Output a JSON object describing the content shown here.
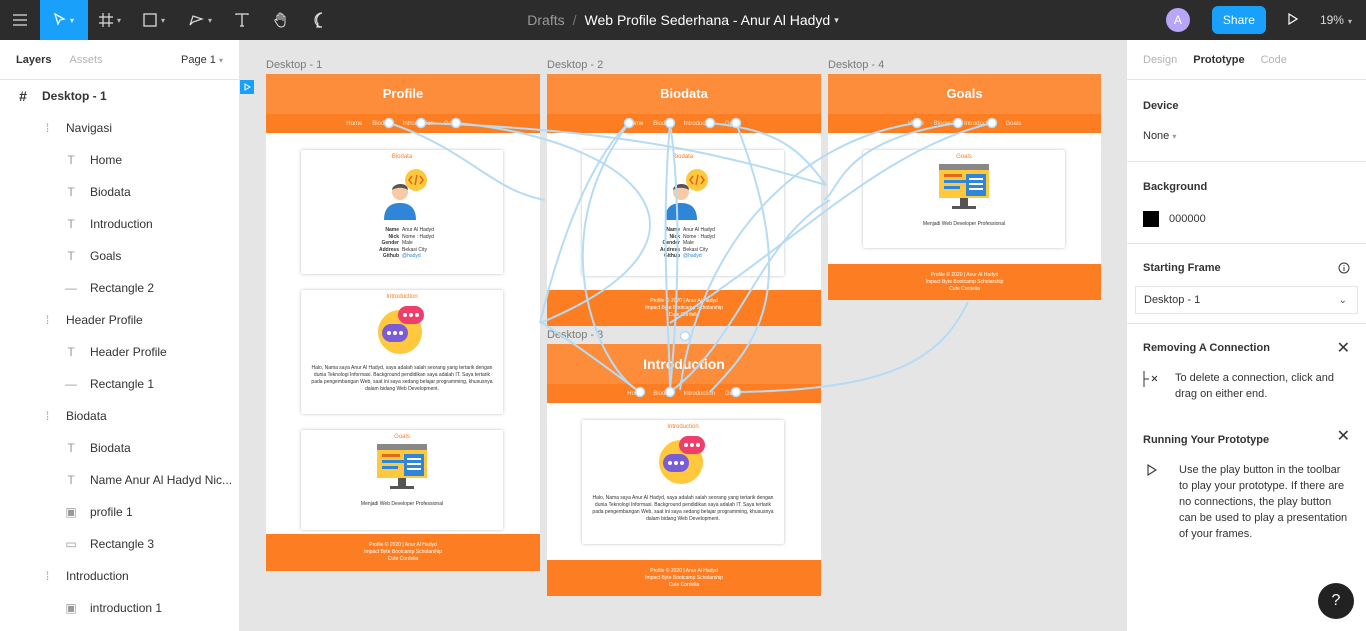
{
  "toolbar": {
    "breadcrumb": "Drafts",
    "separator": "/",
    "document_title": "Web Profile Sederhana - Anur Al Hadyd",
    "avatar_initial": "A",
    "share_label": "Share",
    "zoom": "19%"
  },
  "left_panel": {
    "tab_layers": "Layers",
    "tab_assets": "Assets",
    "page": "Page 1",
    "layers": [
      {
        "label": "Desktop - 1",
        "indent": 0,
        "icon": "frame-icon"
      },
      {
        "label": "Navigasi",
        "indent": 1,
        "icon": "group-icon"
      },
      {
        "label": "Home",
        "indent": 2,
        "icon": "text-icon"
      },
      {
        "label": "Biodata",
        "indent": 2,
        "icon": "text-icon"
      },
      {
        "label": "Introduction",
        "indent": 2,
        "icon": "text-icon"
      },
      {
        "label": "Goals",
        "indent": 2,
        "icon": "text-icon"
      },
      {
        "label": "Rectangle 2",
        "indent": 2,
        "icon": "line-icon"
      },
      {
        "label": "Header Profile",
        "indent": 1,
        "icon": "group-icon"
      },
      {
        "label": "Header Profile",
        "indent": 2,
        "icon": "text-icon"
      },
      {
        "label": "Rectangle 1",
        "indent": 2,
        "icon": "line-icon"
      },
      {
        "label": "Biodata",
        "indent": 1,
        "icon": "group-icon"
      },
      {
        "label": "Biodata",
        "indent": 2,
        "icon": "text-icon"
      },
      {
        "label": "Name Anur Al Hadyd Nic...",
        "indent": 2,
        "icon": "text-icon"
      },
      {
        "label": "profile 1",
        "indent": 2,
        "icon": "image-icon"
      },
      {
        "label": "Rectangle 3",
        "indent": 2,
        "icon": "rectangle-icon"
      },
      {
        "label": "Introduction",
        "indent": 1,
        "icon": "group-icon"
      },
      {
        "label": "introduction 1",
        "indent": 2,
        "icon": "image-icon"
      }
    ]
  },
  "right_panel": {
    "tab_design": "Design",
    "tab_prototype": "Prototype",
    "tab_code": "Code",
    "device_heading": "Device",
    "device_value": "None",
    "background_heading": "Background",
    "background_value": "000000",
    "starting_frame_heading": "Starting Frame",
    "starting_frame_value": "Desktop - 1",
    "removing_heading": "Removing A Connection",
    "removing_text": "To delete a connection, click and drag on either end.",
    "running_heading": "Running Your Prototype",
    "running_text": "Use the play button in the toolbar to play your prototype. If there are no connections, the play button can be used to play a presentation of your frames."
  },
  "canvas": {
    "frames": [
      {
        "label": "Desktop - 1",
        "header": "Profile"
      },
      {
        "label": "Desktop - 2",
        "header": "Biodata"
      },
      {
        "label": "Desktop - 4",
        "header": "Goals"
      },
      {
        "label": "Desktop - 3",
        "header": "Introduction"
      }
    ],
    "nav": {
      "home": "Home",
      "biodata": "Biodata",
      "introduction": "Introduction",
      "goals": "Goals"
    },
    "card_biodata_title": "Biodata",
    "card_intro_title": "Introduction",
    "card_goals_title": "Goals",
    "bio_lines": [
      {
        "k": "Name",
        "v": "Anur Al Hadyd"
      },
      {
        "k": "Nick",
        "v": "Nome : Hadyd"
      },
      {
        "k": "Gender",
        "v": "Male"
      },
      {
        "k": "Address",
        "v": "Bekasi City"
      },
      {
        "k": "Github",
        "v": "@hadyd"
      }
    ],
    "intro_text": "Halo, Nama saya Anur Al Hadyd, saya adalah salah seorang yang tertarik dengan dunia Teknologi Informasi. Background pendidikan saya adalah IT. Saya tertarik pada pengembangan Web, saat ini saya sedang belajar programming, khususnya dalam bidang Web Development.",
    "goals_text": "Menjadi Web Developer Professional",
    "footer_line1": "Profile © 2020 | Anur Al Hadyd",
    "footer_line2": "Impact Byte Bootcamp Scholarship",
    "footer_line3": "Cute Cordelia"
  },
  "colors": {
    "accent": "#18a0fb",
    "orange": "#fd8c3b",
    "orange_dark": "#fd7e22",
    "connector": "#b6dbf5"
  }
}
